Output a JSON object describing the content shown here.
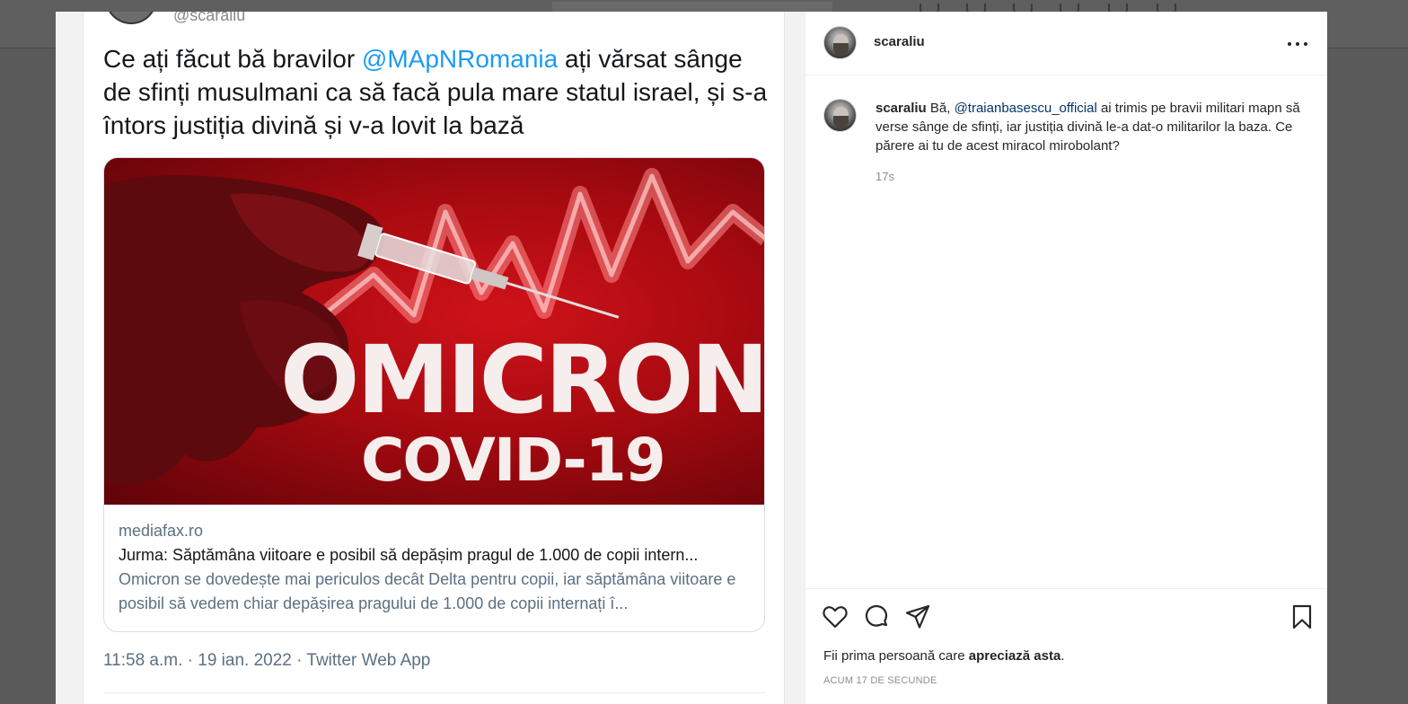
{
  "tweet": {
    "handle": "@scaraliu",
    "text_before": "Ce ați făcut bă bravilor ",
    "mention": "@MApNRomania",
    "text_after": " ați vărsat sânge de sfinți musulmani ca să facă pula mare statul israel, și s-a întors justiția divină și v-a lovit la bază",
    "card": {
      "image_text_line1": "OMICRON",
      "image_text_line2": "COVID-19",
      "domain": "mediafax.ro",
      "title": "Jurma: Săptămâna viitoare e posibil să depășim pragul de 1.000 de copii intern...",
      "description": "Omicron se dovedește mai periculos decât Delta pentru copii, iar săptămâna viitoare e posibil să vedem chiar depășirea pragului de 1.000 de copii internați î..."
    },
    "meta": "11:58 a.m. · 19 ian. 2022 · Twitter Web App"
  },
  "post": {
    "username": "scaraliu",
    "more_icon": "more-horizontal-icon",
    "comment": {
      "username": "scaraliu",
      "text_before": " Bă, ",
      "mention": "@traianbasescu_official",
      "text_after": " ai trimis pe bravii militari mapn să verse sânge de sfinți, iar justiția divină le-a dat-o militarilor la baza. Ce părere ai tu de acest miracol mirobolant?",
      "time": "17s"
    },
    "actions": {
      "like_icon": "heart-icon",
      "comment_icon": "comment-icon",
      "share_icon": "share-icon",
      "save_icon": "bookmark-icon"
    },
    "likes_prefix": "Fii prima persoană care ",
    "likes_bold": "apreciază asta",
    "likes_suffix": ".",
    "ago": "ACUM 17 DE SECUNDE"
  },
  "colors": {
    "twitter_blue": "#1d9bf0",
    "instagram_link": "#00376b",
    "overlay": "#5a5a5a"
  }
}
